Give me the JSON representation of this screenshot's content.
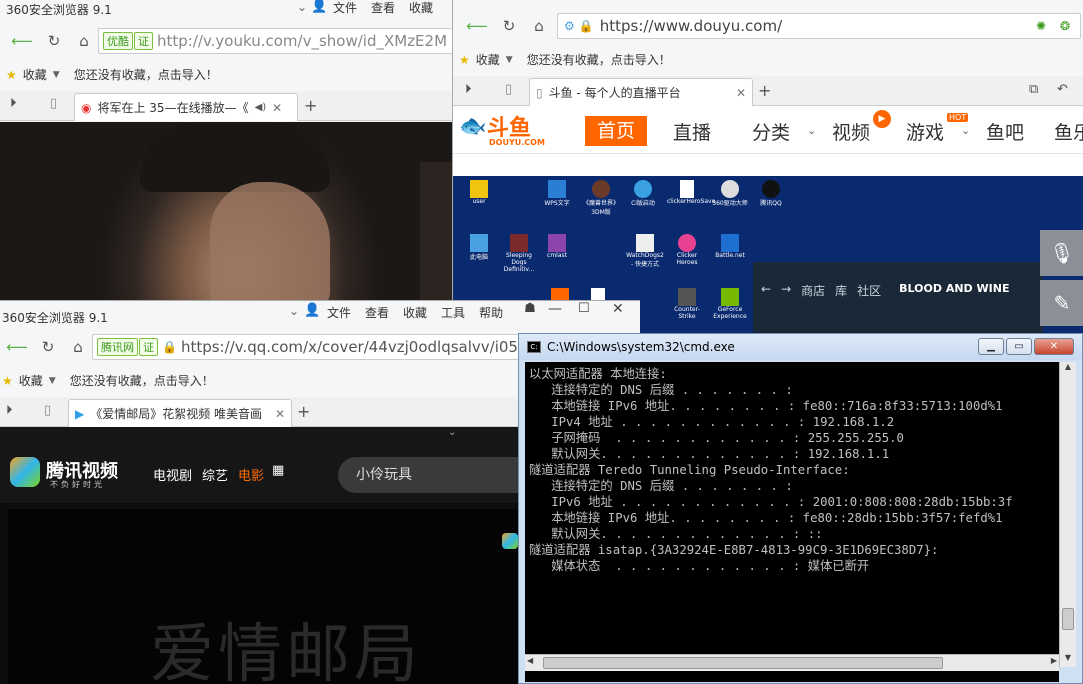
{
  "youku": {
    "title": "360安全浏览器 9.1",
    "menu": [
      "文件",
      "查看",
      "收藏"
    ],
    "badge": "优酷",
    "badge_v": "证",
    "url": "http://v.youku.com/v_show/id_XMzE2M",
    "bookmarks_label": "收藏",
    "bookmarks_hint": "您还没有收藏，点击导入！",
    "tab_title": "将军在上 35—在线播放—《"
  },
  "douyu": {
    "url": "https://www.douyu.com/",
    "bookmarks_label": "收藏",
    "bookmarks_hint": "您还没有收藏，点击导入！",
    "tab_title": "斗鱼 - 每个人的直播平台",
    "logo_text": "斗鱼",
    "logo_sub": "DOUYU.COM",
    "nav": [
      "首页",
      "直播",
      "分类",
      "视频",
      "游戏",
      "鱼吧",
      "鱼乐"
    ],
    "hot_badge": "HOT",
    "desktop_icons": [
      "user",
      "WPS文字",
      "《魔兽世界》3DM版",
      "Ci版启动",
      "clickerHeroSave",
      "360驱动大师",
      "腾讯QQ",
      "此电脑",
      "Sleeping Dogs Definitiv...",
      "cmlast",
      "WatchDogs2 - 快捷方式",
      "Clicker Heroes",
      "Battle.net",
      "Counter-Strike",
      "GeForce Experience"
    ],
    "steam_nav": [
      "商店",
      "库",
      "社区"
    ],
    "steam_title": "BLOOD AND WINE"
  },
  "qq": {
    "title": "360安全浏览器 9.1",
    "menu": [
      "文件",
      "查看",
      "收藏",
      "工具",
      "帮助"
    ],
    "badge": "腾讯网",
    "badge_v": "证",
    "url": "https://v.qq.com/x/cover/44vzj0odlqsalvv/i05",
    "bookmarks_label": "收藏",
    "bookmarks_hint": "您还没有收藏，点击导入！",
    "tab_title": "《爱情邮局》花絮视频 唯美音画",
    "logo_text": "腾讯视频",
    "logo_sub": "不负好时光",
    "nav": [
      "电视剧",
      "综艺",
      "电影"
    ],
    "search_text": "小伶玩具",
    "watermark": "爱情邮局"
  },
  "cmd": {
    "title": "C:\\Windows\\system32\\cmd.exe",
    "lines": [
      "以太网适配器 本地连接:",
      "",
      "   连接特定的 DNS 后缀 . . . . . . . :",
      "   本地链接 IPv6 地址. . . . . . . . : fe80::716a:8f33:5713:100d%1",
      "   IPv4 地址 . . . . . . . . . . . . : 192.168.1.2",
      "   子网掩码  . . . . . . . . . . . . : 255.255.255.0",
      "   默认网关. . . . . . . . . . . . . : 192.168.1.1",
      "",
      "隧道适配器 Teredo Tunneling Pseudo-Interface:",
      "",
      "   连接特定的 DNS 后缀 . . . . . . . :",
      "   IPv6 地址 . . . . . . . . . . . . : 2001:0:808:808:28db:15bb:3f",
      "   本地链接 IPv6 地址. . . . . . . . : fe80::28db:15bb:3f57:fefd%1",
      "   默认网关. . . . . . . . . . . . . : ::",
      "",
      "隧道适配器 isatap.{3A32924E-E8B7-4813-99C9-3E1D69EC38D7}:",
      "",
      "   媒体状态  . . . . . . . . . . . . : 媒体已断开"
    ]
  },
  "colors": {
    "douyu_orange": "#f60",
    "qq_active": "#ff6a00",
    "accent_green": "#3a9a1a"
  }
}
